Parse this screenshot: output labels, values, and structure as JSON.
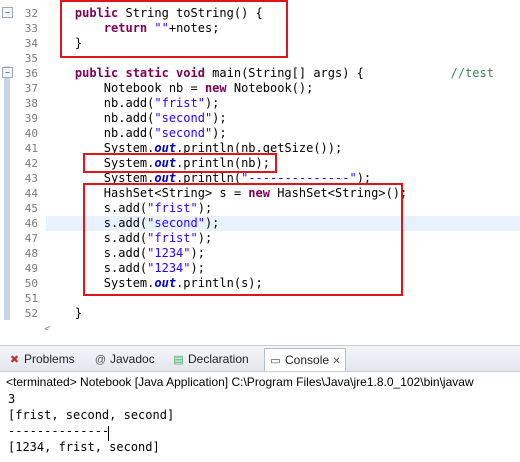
{
  "editor": {
    "line_numbers": [
      "32",
      "33",
      "34",
      "35",
      "36",
      "37",
      "38",
      "39",
      "40",
      "41",
      "42",
      "43",
      "44",
      "45",
      "46",
      "47",
      "48",
      "49",
      "50",
      "51",
      "52"
    ],
    "lines": {
      "l32_kw": "public",
      "l32_rest": " String toString() {",
      "l33_kw": "return",
      "l33_str": "\"\"",
      "l33_rest": "+notes;",
      "l34": "}",
      "l36_kw": "public static void",
      "l36_rest": " main(String[] args) {",
      "l36_comment": "//test",
      "l37_a": "Notebook nb = ",
      "l37_kw": "new",
      "l37_b": " Notebook();",
      "l38_a": "nb.add(",
      "l38_str": "\"frist\"",
      "l38_b": ");",
      "l39_a": "nb.add(",
      "l39_str": "\"second\"",
      "l39_b": ");",
      "l40_a": "nb.add(",
      "l40_str": "\"second\"",
      "l40_b": ");",
      "l41_a": "System.",
      "l41_fld": "out",
      "l41_b": ".println(nb.getSize());",
      "l42_a": "System.",
      "l42_fld": "out",
      "l42_b": ".println(nb);",
      "l43_a": "System.",
      "l43_fld": "out",
      "l43_b": ".println(",
      "l43_str": "\"--------------\"",
      "l43_c": ");",
      "l44_a": "HashSet<String> s = ",
      "l44_kw": "new",
      "l44_b": " HashSet<String>();",
      "l45_a": "s.add(",
      "l45_str": "\"frist\"",
      "l45_b": ");",
      "l46_a": "s.add(",
      "l46_str": "\"second\"",
      "l46_b": ");",
      "l47_a": "s.add(",
      "l47_str": "\"frist\"",
      "l47_b": ");",
      "l48_a": "s.add(",
      "l48_str": "\"1234\"",
      "l48_b": ");",
      "l49_a": "s.add(",
      "l49_str": "\"1234\"",
      "l49_b": ");",
      "l50_a": "System.",
      "l50_fld": "out",
      "l50_b": ".println(s);",
      "l52": "}"
    },
    "hscroll_left": "<"
  },
  "views": {
    "tabs": [
      {
        "label": "Problems",
        "icon": "problems-icon"
      },
      {
        "label": "Javadoc",
        "icon": "javadoc-icon"
      },
      {
        "label": "Declaration",
        "icon": "declaration-icon"
      },
      {
        "label": "Console",
        "icon": "console-icon",
        "close": "✕"
      }
    ],
    "status": "<terminated> Notebook [Java Application] C:\\Program Files\\Java\\jre1.8.0_102\\bin\\javaw",
    "output": [
      "3",
      "[frist, second, second]",
      "--------------",
      "[1234, frist, second]"
    ]
  },
  "colors": {
    "keyword": "#7f0055",
    "string": "#2a00ff",
    "field": "#0000c0",
    "comment": "#3f7f5f",
    "annotation_box": "#e0141b"
  }
}
